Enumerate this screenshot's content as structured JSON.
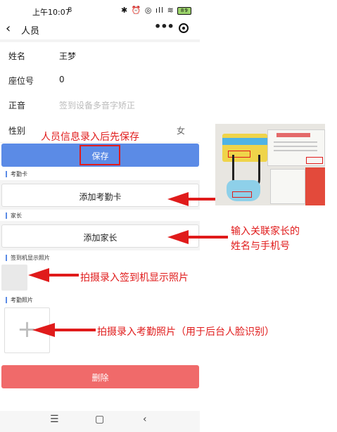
{
  "status_bar": {
    "time": "上午10:07",
    "time_icon": "8",
    "icons": "✱ ⏰ ◎ ıll ≋",
    "battery": "89"
  },
  "navbar": {
    "back_glyph": "‹",
    "title": "人员",
    "more_glyph": "•••"
  },
  "form": {
    "name_label": "姓名",
    "name_value": "王梦",
    "seat_label": "座位号",
    "seat_value": "0",
    "pron_label": "正音",
    "pron_placeholder": "签到设备多音字矫正",
    "gender_label": "性别",
    "gender_value": "女"
  },
  "buttons": {
    "save": "保存",
    "add_card": "添加考勤卡",
    "add_parent": "添加家长",
    "delete": "删除"
  },
  "sections": {
    "card": "考勤卡",
    "parent": "家长",
    "checkin_photo": "签到机显示照片",
    "attendance_photo": "考勤照片"
  },
  "plus_glyph": "+",
  "bottom_nav": {
    "menu": "☰",
    "home": "▢",
    "back": "‹"
  },
  "annotations": {
    "save_first": "人员信息录入后先保存",
    "parent_1": "输入关联家长的",
    "parent_2": "姓名与手机号",
    "checkin": "拍摄录入签到机显示照片",
    "attendance": "拍摄录入考勤照片（用于后台人脸识别）"
  },
  "colors": {
    "primary": "#5b8be6",
    "danger": "#f06a6a",
    "annotation": "#e01b1b"
  }
}
